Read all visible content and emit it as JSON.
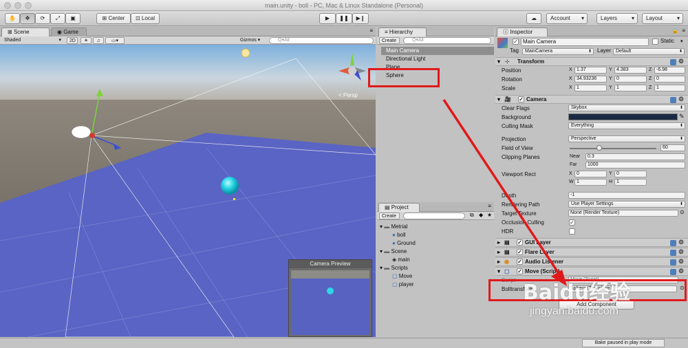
{
  "window": {
    "title": "main.unity - boll - PC, Mac & Linux Standalone (Personal)"
  },
  "toolbar": {
    "tools": [
      "hand-icon",
      "move-icon",
      "rotate-icon",
      "scale-icon",
      "rect-icon"
    ],
    "pivot": "Center",
    "space": "Local",
    "account": "Account",
    "layers": "Layers",
    "layout": "Layout"
  },
  "scene": {
    "tab_scene": "Scene",
    "tab_game": "Game",
    "shading": "Shaded",
    "mode_2d": "2D",
    "gizmos": "Gizmos",
    "search_placeholder": "Q▾All",
    "persp": "Persp",
    "camera_preview": "Camera Preview"
  },
  "hierarchy": {
    "tab": "Hierarchy",
    "create": "Create",
    "search_placeholder": "Q▾All",
    "items": [
      "Main Camera",
      "Directional Light",
      "Plane",
      "Sphere"
    ]
  },
  "project": {
    "tab": "Project",
    "create": "Create",
    "tree": [
      {
        "label": "Metrial",
        "kind": "folder",
        "depth": 0
      },
      {
        "label": "boll",
        "kind": "material",
        "depth": 1
      },
      {
        "label": "Ground",
        "kind": "material",
        "depth": 1
      },
      {
        "label": "Scene",
        "kind": "folder",
        "depth": 0
      },
      {
        "label": "main",
        "kind": "scene",
        "depth": 1
      },
      {
        "label": "Scripts",
        "kind": "folder",
        "depth": 0
      },
      {
        "label": "Move",
        "kind": "script",
        "depth": 1
      },
      {
        "label": "player",
        "kind": "script",
        "depth": 1
      }
    ]
  },
  "inspector": {
    "tab": "Inspector",
    "object_name": "Main Camera",
    "static_label": "Static",
    "tag_label": "Tag",
    "tag_value": "MainCamera",
    "layer_label": "Layer",
    "layer_value": "Default",
    "transform": {
      "title": "Transform",
      "position_label": "Position",
      "rotation_label": "Rotation",
      "scale_label": "Scale",
      "axis_x": "X",
      "axis_y": "Y",
      "axis_z": "Z",
      "position": [
        "1.37",
        "4.383",
        "-6.98"
      ],
      "rotation": [
        "34.93236",
        "0",
        "0"
      ],
      "scale": [
        "1",
        "1",
        "1"
      ]
    },
    "camera": {
      "title": "Camera",
      "clear_flags_label": "Clear Flags",
      "clear_flags": "Skybox",
      "background_label": "Background",
      "background_color": "#1b2a44",
      "culling_mask_label": "Culling Mask",
      "culling_mask": "Everything",
      "projection_label": "Projection",
      "projection": "Perspective",
      "fov_label": "Field of View",
      "fov": "60",
      "fov_fraction": 0.333,
      "clipping_label": "Clipping Planes",
      "near_label": "Near",
      "near": "0.3",
      "far_label": "Far",
      "far": "1000",
      "viewport_label": "Viewport Rect",
      "vp_x_label": "X",
      "vp_y_label": "Y",
      "vp_w_label": "W",
      "vp_h_label": "H",
      "vp_x": "0",
      "vp_y": "0",
      "vp_w": "1",
      "vp_h": "1",
      "depth_label": "Depth",
      "depth": "-1",
      "rendering_path_label": "Rendering Path",
      "rendering_path": "Use Player Settings",
      "target_texture_label": "Target Texture",
      "target_texture": "None (Render Texture)",
      "occlusion_label": "Occlusion Culling",
      "hdr_label": "HDR"
    },
    "gui_layer": "GUI Layer",
    "flare_layer": "Flare Layer",
    "audio_listener": "Audio Listener",
    "move_script": "Move (Script)",
    "script_label": "Script",
    "bolltransform_label": "Bolltransform",
    "bolltransform_value": "Sphere (Transform)",
    "add_component": "Add Component"
  },
  "status": {
    "bake": "Bake paused in play mode"
  },
  "watermark": {
    "text": "Baidu经验",
    "url": "jingyan.baidu.com"
  },
  "colors": {
    "highlight": "#e0191b",
    "selection": "#8e8e8e"
  }
}
